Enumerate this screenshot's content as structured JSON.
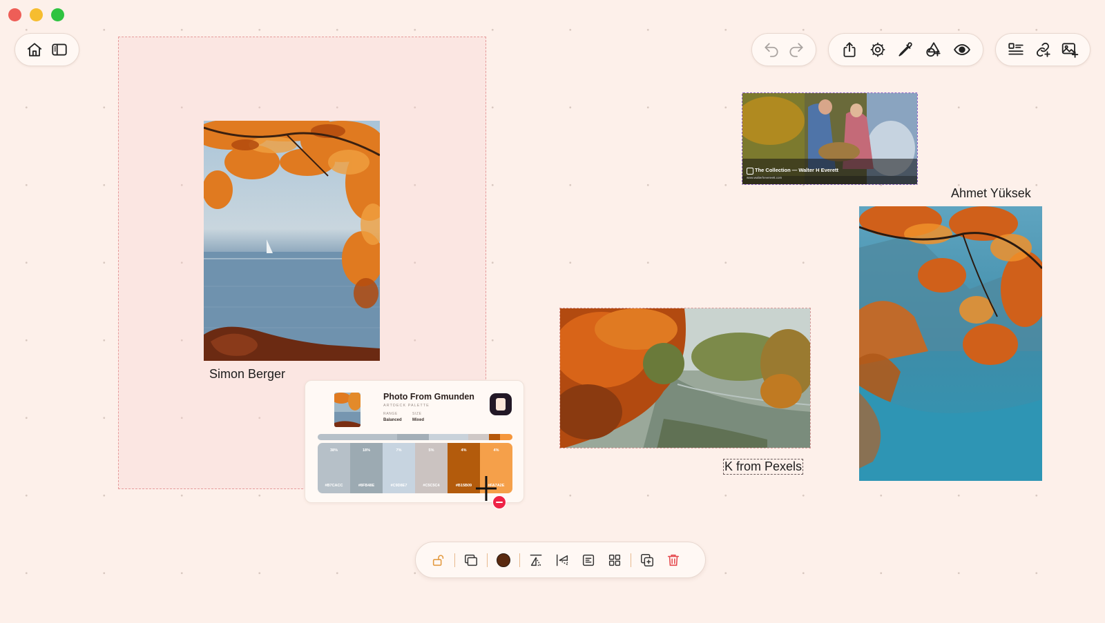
{
  "window": {
    "traffic_lights": {
      "close": "#ee5e57",
      "minimize": "#f6bd2f",
      "zoom": "#2fc341"
    }
  },
  "toolbar_left": {
    "icons": [
      "home-icon",
      "sidebar-icon"
    ]
  },
  "toolbar_history": {
    "icons": [
      "undo-icon",
      "redo-icon"
    ]
  },
  "toolbar_tools": {
    "icons": [
      "share-icon",
      "settings-icon",
      "eyedropper-icon",
      "add-shape-icon",
      "preview-eye-icon"
    ]
  },
  "toolbar_right": {
    "icons": [
      "add-text-icon",
      "add-link-icon",
      "add-image-icon"
    ]
  },
  "canvas": {
    "captions": {
      "simon": "Simon Berger",
      "ahmet": "Ahmet Yüksek",
      "k": "K from Pexels"
    },
    "link_card": {
      "title": "The Collection — Walter H Everett",
      "url": "www.walterhevereett.com"
    }
  },
  "palette_card": {
    "title": "Photo From Gmunden",
    "subtitle": "ARTDECK PALETTE",
    "range_label": "RANGE",
    "range_value": "Balanced",
    "size_label": "SIZE",
    "size_value": "Mixed",
    "bar_colors": [
      "#b6c0c8",
      "#a3aeb7",
      "#c9d2da",
      "#cfc8c6",
      "#b5580a",
      "#f5963b"
    ],
    "swatches": [
      {
        "pct": "38%",
        "hex": "#B7CACC",
        "color": "#b6c0c8"
      },
      {
        "pct": "18%",
        "hex": "#8FB48E",
        "color": "#9caab2"
      },
      {
        "pct": "7%",
        "hex": "#C9D8E7",
        "color": "#c7d4e0"
      },
      {
        "pct": "5%",
        "hex": "#C5C5C4",
        "color": "#cbc3c1"
      },
      {
        "pct": "4%",
        "hex": "#B15B09",
        "color": "#b35b0c"
      },
      {
        "pct": "4%",
        "hex": "#FA7A2E",
        "color": "#f5a04a"
      }
    ]
  },
  "bottom_toolbar": {
    "icons": [
      "unlock-icon",
      "layers-icon",
      "color-swatch-icon",
      "flip-vertical-icon",
      "flip-horizontal-icon",
      "adjust-icon",
      "grid-icon",
      "duplicate-icon",
      "trash-icon"
    ],
    "color_value": "#5a2a10"
  }
}
